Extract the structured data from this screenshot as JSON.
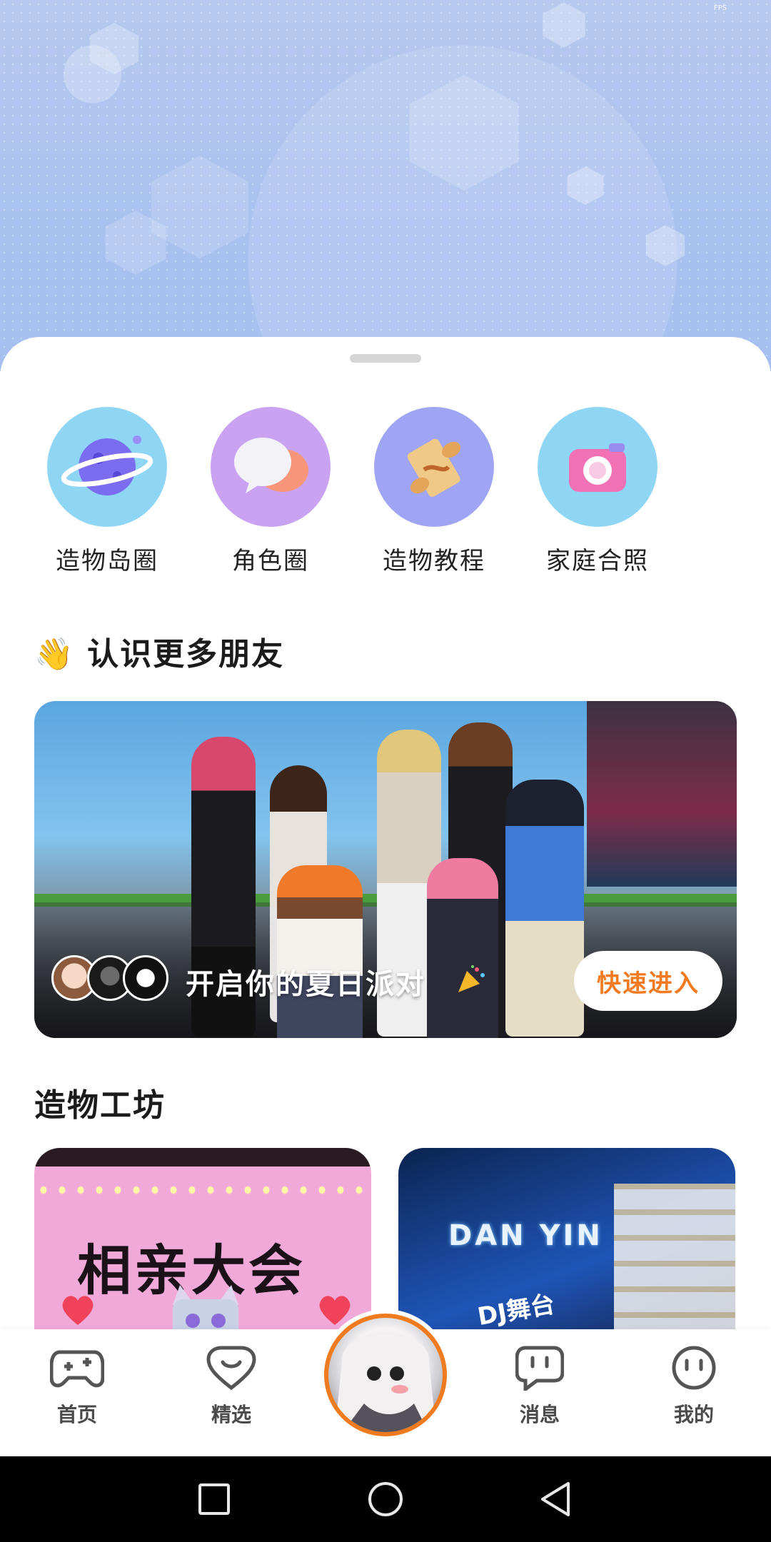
{
  "status": {
    "fps": "FPS"
  },
  "quick_actions": [
    {
      "label": "造物岛圈",
      "icon": "planet-icon",
      "color": "#8fd6f5"
    },
    {
      "label": "角色圈",
      "icon": "chat-bubbles-icon",
      "color": "#c9a3f2"
    },
    {
      "label": "造物教程",
      "icon": "scroll-icon",
      "color": "#9fa5f4"
    },
    {
      "label": "家庭合照",
      "icon": "camera-icon",
      "color": "#8fd6f5"
    }
  ],
  "friends_section": {
    "emoji": "👋",
    "title": "认识更多朋友",
    "banner_text": "开启你的夏日派对",
    "enter_button": "快速进入"
  },
  "workshop_section": {
    "title": "造物工坊",
    "cards": [
      {
        "title": "相亲大会"
      },
      {
        "title": "DAN YIN",
        "subtitle": "DJ舞台"
      }
    ]
  },
  "bottom_nav": [
    {
      "label": "首页",
      "icon": "gamepad-icon"
    },
    {
      "label": "精选",
      "icon": "heart-chat-icon"
    },
    {
      "label": "消息",
      "icon": "message-icon"
    },
    {
      "label": "我的",
      "icon": "face-icon"
    }
  ],
  "colors": {
    "accent": "#f47a1f",
    "hero_bg": "#a9c1ef"
  }
}
